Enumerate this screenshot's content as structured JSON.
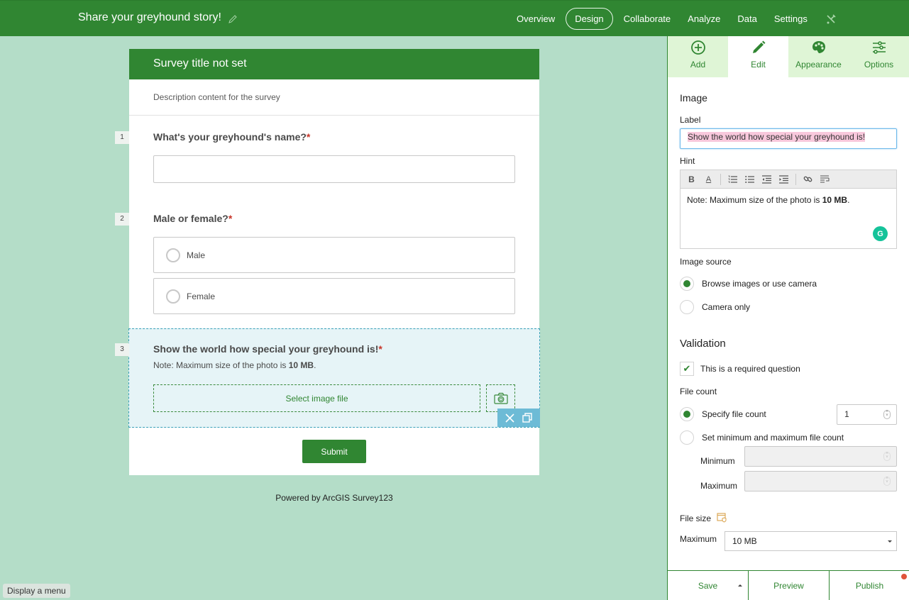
{
  "header": {
    "app_title": "Share your greyhound story!",
    "nav": [
      {
        "label": "Overview",
        "active": false
      },
      {
        "label": "Design",
        "active": true
      },
      {
        "label": "Collaborate",
        "active": false
      },
      {
        "label": "Analyze",
        "active": false
      },
      {
        "label": "Data",
        "active": false
      },
      {
        "label": "Settings",
        "active": false
      }
    ],
    "nav_icon": "tools-icon"
  },
  "survey": {
    "title": "Survey title not set",
    "description": "Description content for the survey",
    "questions": [
      {
        "number": "1",
        "label": "What's your greyhound's name?",
        "required_mark": "*",
        "type": "text",
        "value": ""
      },
      {
        "number": "2",
        "label": "Male or female?",
        "required_mark": "*",
        "type": "radio",
        "options": [
          "Male",
          "Female"
        ]
      },
      {
        "number": "3",
        "label": "Show the world how special your greyhound is!",
        "required_mark": "*",
        "type": "image",
        "hint_prefix": "Note: Maximum size of the photo is ",
        "hint_bold": "10 MB",
        "hint_suffix": ".",
        "select_label": "Select image file",
        "selected": true
      }
    ],
    "submit_label": "Submit",
    "powered_by": "Powered by ArcGIS Survey123"
  },
  "tooltip": "Display a menu",
  "panel": {
    "tabs": [
      {
        "label": "Add",
        "icon": "plus-circle-icon",
        "active": false
      },
      {
        "label": "Edit",
        "icon": "pencil-icon",
        "active": true
      },
      {
        "label": "Appearance",
        "icon": "palette-icon",
        "active": false
      },
      {
        "label": "Options",
        "icon": "sliders-icon",
        "active": false
      }
    ],
    "section_title": "Image",
    "label_field": {
      "label": "Label",
      "value": "Show the world how special your greyhound is!"
    },
    "hint_field": {
      "label": "Hint",
      "text_prefix": "Note: Maximum size of the photo is ",
      "text_bold": "10 MB",
      "text_suffix": "."
    },
    "image_source": {
      "label": "Image source",
      "options": [
        {
          "label": "Browse images or use camera",
          "selected": true
        },
        {
          "label": "Camera only",
          "selected": false
        }
      ]
    },
    "validation": {
      "title": "Validation",
      "required_label": "This is a required question",
      "required_checked": true,
      "file_count_label": "File count",
      "specify_label": "Specify file count",
      "specify_selected": true,
      "specify_value": "1",
      "minmax_label": "Set minimum and maximum file count",
      "minimum_label": "Minimum",
      "maximum_label": "Maximum",
      "minimum_value": "",
      "maximum_value": ""
    },
    "file_size": {
      "label": "File size",
      "max_label": "Maximum",
      "max_value": "10 MB"
    },
    "footer": {
      "save": "Save",
      "preview": "Preview",
      "publish": "Publish"
    }
  }
}
